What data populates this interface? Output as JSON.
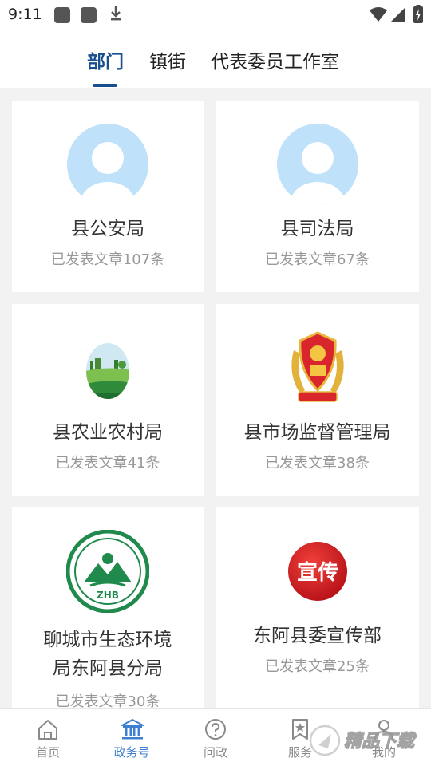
{
  "status_bar": {
    "time": "9:11"
  },
  "tabs": [
    {
      "label": "部门",
      "active": true
    },
    {
      "label": "镇街",
      "active": false
    },
    {
      "label": "代表委员工作室",
      "active": false
    }
  ],
  "cards": [
    {
      "name": "县公安局",
      "count": "已发表文章107条",
      "icon": "default-avatar"
    },
    {
      "name": "县司法局",
      "count": "已发表文章67条",
      "icon": "default-avatar"
    },
    {
      "name": "县农业农村局",
      "count": "已发表文章41条",
      "icon": "farm-landscape-logo"
    },
    {
      "name": "县市场监督管理局",
      "count": "已发表文章38条",
      "icon": "market-supervision-emblem"
    },
    {
      "name_line1": "聊城市生态环境",
      "name_line2": "局东阿县分局",
      "count": "已发表文章30条",
      "icon": "zhb-environment-logo",
      "logo_text": "ZHB"
    },
    {
      "name": "东阿县委宣传部",
      "count": "已发表文章25条",
      "icon": "propaganda-seal-logo",
      "logo_text": "宣传"
    }
  ],
  "bottom_nav": [
    {
      "label": "首页",
      "icon": "home-icon",
      "active": false
    },
    {
      "label": "政务号",
      "icon": "government-building-icon",
      "active": true
    },
    {
      "label": "问政",
      "icon": "question-icon",
      "active": false
    },
    {
      "label": "服务",
      "icon": "bookmark-star-icon",
      "active": false
    },
    {
      "label": "我的",
      "icon": "person-icon",
      "active": false
    }
  ],
  "watermark": {
    "text": "精品下载"
  },
  "colors": {
    "accent": "#1a4f8f",
    "nav_active": "#3d7fd0",
    "avatar_bg": "#bfe1fa",
    "muted_text": "#999999"
  }
}
